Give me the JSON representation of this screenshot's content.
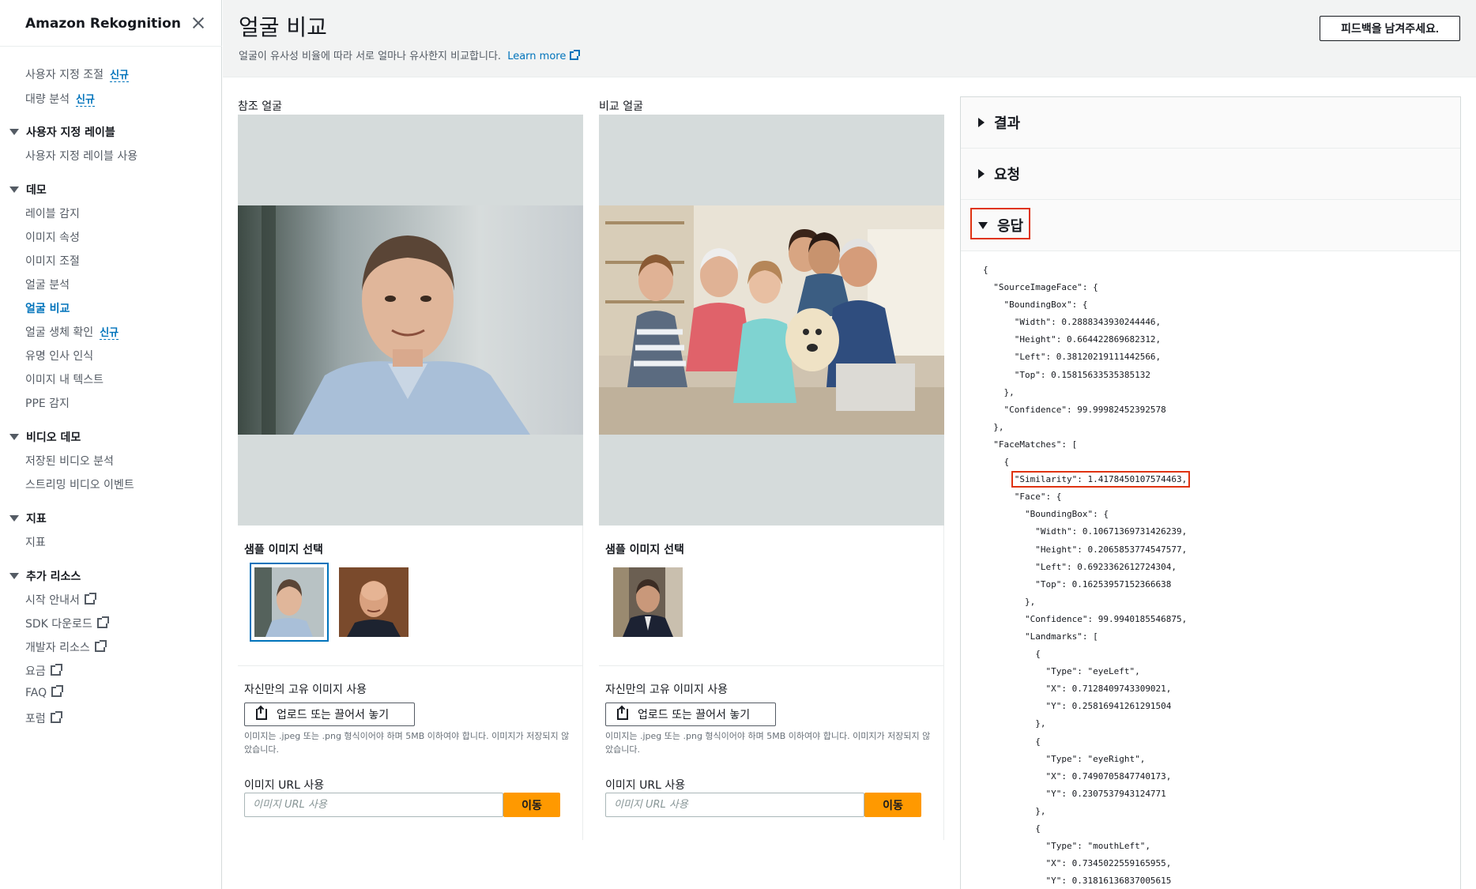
{
  "sidebar": {
    "title": "Amazon Rekognition",
    "top_items": [
      {
        "label": "사용자 지정 조절",
        "badge": "신규"
      },
      {
        "label": "대량 분석",
        "badge": "신규"
      }
    ],
    "sections": [
      {
        "title": "사용자 지정 레이블",
        "items": [
          {
            "label": "사용자 지정 레이블 사용"
          }
        ]
      },
      {
        "title": "데모",
        "items": [
          {
            "label": "레이블 감지"
          },
          {
            "label": "이미지 속성"
          },
          {
            "label": "이미지 조절"
          },
          {
            "label": "얼굴 분석"
          },
          {
            "label": "얼굴 비교"
          },
          {
            "label": "얼굴 생체 확인",
            "badge": "신규"
          },
          {
            "label": "유명 인사 인식"
          },
          {
            "label": "이미지 내 텍스트"
          },
          {
            "label": "PPE 감지"
          }
        ]
      },
      {
        "title": "비디오 데모",
        "items": [
          {
            "label": "저장된 비디오 분석"
          },
          {
            "label": "스트리밍 비디오 이벤트"
          }
        ]
      },
      {
        "title": "지표",
        "items": [
          {
            "label": "지표"
          }
        ]
      },
      {
        "title": "추가 리소스",
        "items": [
          {
            "label": "시작 안내서"
          },
          {
            "label": "SDK 다운로드"
          },
          {
            "label": "개발자 리소스"
          },
          {
            "label": "요금"
          },
          {
            "label": "FAQ"
          },
          {
            "label": "포럼"
          }
        ]
      }
    ]
  },
  "header": {
    "title": "얼굴 비교",
    "description": "얼굴이 유사성 비율에 따라 서로 얼마나 유사한지 비교합니다.",
    "learn_more": "Learn more",
    "feedback_button": "피드백을 남겨주세요."
  },
  "reference": {
    "label": "참조 얼굴",
    "sample_title": "샘플 이미지 선택",
    "own_image_title": "자신만의 고유 이미지 사용",
    "upload_button": "업로드 또는 끌어서 놓기",
    "hint": "이미지는 .jpeg 또는 .png 형식이어야 하며 5MB 이하여야 합니다. 이미지가 저장되지 않았습니다.",
    "url_title": "이미지 URL 사용",
    "url_placeholder": "이미지 URL 사용",
    "go_button": "이동"
  },
  "comparison": {
    "label": "비교 얼굴",
    "sample_title": "샘플 이미지 선택",
    "own_image_title": "자신만의 고유 이미지 사용",
    "upload_button": "업로드 또는 끌어서 놓기",
    "hint": "이미지는 .jpeg 또는 .png 형식이어야 하며 5MB 이하여야 합니다. 이미지가 저장되지 않았습니다.",
    "url_title": "이미지 URL 사용",
    "url_placeholder": "이미지 URL 사용",
    "go_button": "이동"
  },
  "results": {
    "sections": [
      {
        "label": "결과",
        "expanded": false
      },
      {
        "label": "요청",
        "expanded": false
      },
      {
        "label": "응답",
        "expanded": true
      }
    ],
    "json_lines": [
      "{",
      "  \"SourceImageFace\": {",
      "    \"BoundingBox\": {",
      "      \"Width\": 0.2888343930244446,",
      "      \"Height\": 0.664422869682312,",
      "      \"Left\": 0.38120219111442566,",
      "      \"Top\": 0.15815633535385132",
      "    },",
      "    \"Confidence\": 99.99982452392578",
      "  },",
      "  \"FaceMatches\": [",
      "    {",
      "      \"Similarity\": 1.4178450107574463,",
      "      \"Face\": {",
      "        \"BoundingBox\": {",
      "          \"Width\": 0.10671369731426239,",
      "          \"Height\": 0.2065853774547577,",
      "          \"Left\": 0.6923362612724304,",
      "          \"Top\": 0.16253957152366638",
      "        },",
      "        \"Confidence\": 99.9940185546875,",
      "        \"Landmarks\": [",
      "          {",
      "            \"Type\": \"eyeLeft\",",
      "            \"X\": 0.7128409743309021,",
      "            \"Y\": 0.25816941261291504",
      "          },",
      "          {",
      "            \"Type\": \"eyeRight\",",
      "            \"X\": 0.7490705847740173,",
      "            \"Y\": 0.2307537943124771",
      "          },",
      "          {",
      "            \"Type\": \"mouthLeft\",",
      "            \"X\": 0.7345022559165955,",
      "            \"Y\": 0.31816136837005615"
    ],
    "highlight_line": 12
  },
  "colors": {
    "accent": "#0073bb",
    "go_button": "#ff9900",
    "highlight": "#df3312"
  }
}
